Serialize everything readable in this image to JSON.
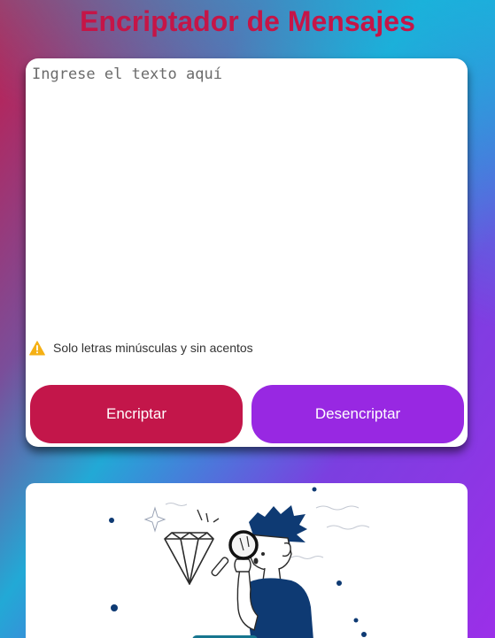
{
  "header": {
    "title": "Encriptador de Mensajes"
  },
  "input": {
    "placeholder": "Ingrese el texto aquí",
    "value": ""
  },
  "warning": {
    "icon": "warning-triangle-icon",
    "text": "Solo letras minúsculas y sin acentos"
  },
  "actions": {
    "encrypt_label": "Encriptar",
    "decrypt_label": "Desencriptar"
  },
  "output": {
    "illustration": "person-with-magnifying-glass-diamond"
  },
  "colors": {
    "title": "#c51547",
    "encrypt_button": "#c3164a",
    "decrypt_button": "#9828e2",
    "warning_icon": "#f5b014",
    "illustration_blue": "#0e3a73"
  }
}
